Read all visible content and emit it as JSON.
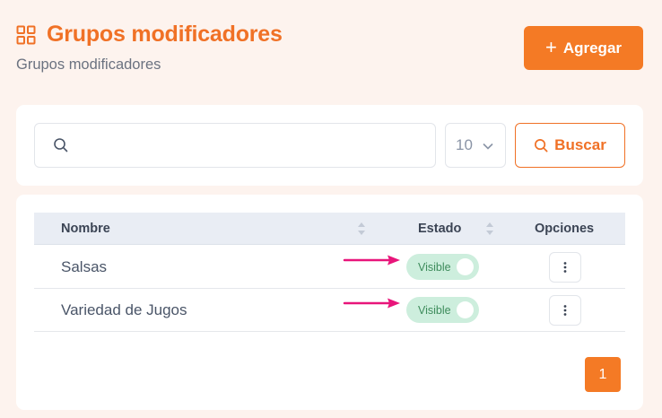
{
  "header": {
    "title": "Grupos modificadores",
    "subtitle": "Grupos modificadores",
    "icon": "grid-icon",
    "add_label": "Agregar"
  },
  "search": {
    "placeholder": "",
    "per_page": "10",
    "button_label": "Buscar"
  },
  "table": {
    "columns": [
      "Nombre",
      "Estado",
      "Opciones"
    ],
    "rows": [
      {
        "name": "Salsas",
        "status": "Visible"
      },
      {
        "name": "Variedad de Jugos",
        "status": "Visible"
      }
    ]
  },
  "pagination": {
    "current": "1"
  },
  "colors": {
    "accent": "#f47a25",
    "background": "#fdf3ee",
    "toggle_bg": "#cdeedd",
    "annotation_arrow": "#e8157a"
  }
}
